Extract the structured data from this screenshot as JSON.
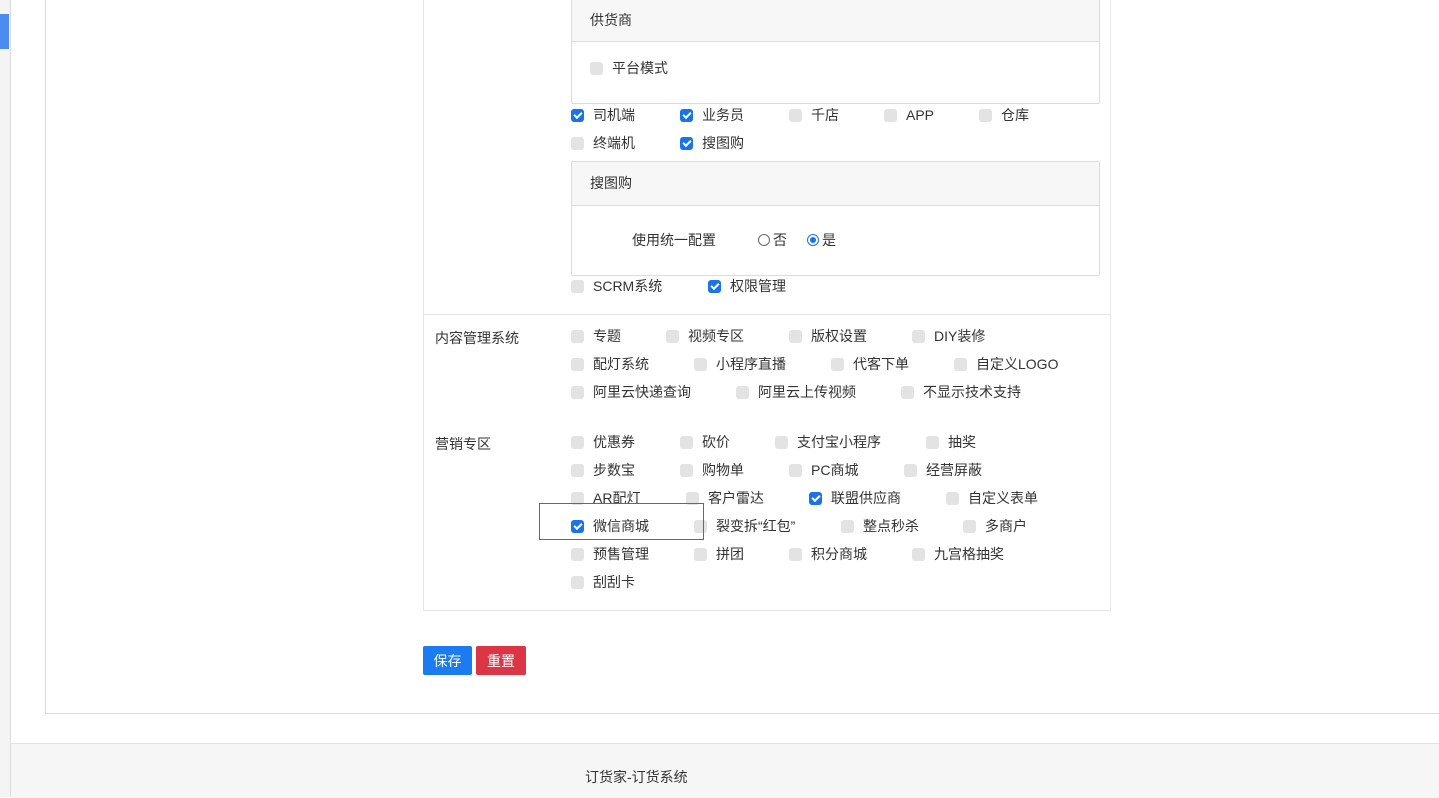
{
  "supplier_panel": {
    "title": "供货商",
    "items": [
      {
        "label": "平台模式",
        "checked": false
      }
    ]
  },
  "modules": {
    "row1": [
      {
        "label": "司机端",
        "checked": true
      },
      {
        "label": "业务员",
        "checked": true
      },
      {
        "label": "千店",
        "checked": false
      },
      {
        "label": "APP",
        "checked": false
      },
      {
        "label": "仓库",
        "checked": false
      }
    ],
    "row2": [
      {
        "label": "终端机",
        "checked": false
      },
      {
        "label": "搜图购",
        "checked": true
      }
    ]
  },
  "soutugou_panel": {
    "title": "搜图购",
    "config_label": "使用统一配置",
    "options": [
      {
        "label": "否",
        "selected": false
      },
      {
        "label": "是",
        "selected": true
      }
    ]
  },
  "modules_extra": [
    {
      "label": "SCRM系统",
      "checked": false
    },
    {
      "label": "权限管理",
      "checked": true
    }
  ],
  "cms": {
    "title": "内容管理系统",
    "items": [
      {
        "label": "专题",
        "checked": false
      },
      {
        "label": "视频专区",
        "checked": false
      },
      {
        "label": "版权设置",
        "checked": false
      },
      {
        "label": "DIY装修",
        "checked": false
      },
      {
        "label": "配灯系统",
        "checked": false
      },
      {
        "label": "小程序直播",
        "checked": false
      },
      {
        "label": "代客下单",
        "checked": false
      },
      {
        "label": "自定义LOGO",
        "checked": false
      },
      {
        "label": "阿里云快递查询",
        "checked": false
      },
      {
        "label": "阿里云上传视频",
        "checked": false
      },
      {
        "label": "不显示技术支持",
        "checked": false
      }
    ]
  },
  "marketing": {
    "title": "营销专区",
    "items": [
      {
        "label": "优惠券",
        "checked": false
      },
      {
        "label": "砍价",
        "checked": false
      },
      {
        "label": "支付宝小程序",
        "checked": false
      },
      {
        "label": "抽奖",
        "checked": false
      },
      {
        "label": "步数宝",
        "checked": false
      },
      {
        "label": "购物单",
        "checked": false
      },
      {
        "label": "PC商城",
        "checked": false
      },
      {
        "label": "经营屏蔽",
        "checked": false
      },
      {
        "label": "AR配灯",
        "checked": false
      },
      {
        "label": "客户雷达",
        "checked": false
      },
      {
        "label": "联盟供应商",
        "checked": true
      },
      {
        "label": "自定义表单",
        "checked": false
      },
      {
        "label": "微信商城",
        "checked": true
      },
      {
        "label": "裂变拆“红包”",
        "checked": false
      },
      {
        "label": "整点秒杀",
        "checked": false
      },
      {
        "label": "多商户",
        "checked": false
      },
      {
        "label": "预售管理",
        "checked": false
      },
      {
        "label": "拼团",
        "checked": false
      },
      {
        "label": "积分商城",
        "checked": false
      },
      {
        "label": "九宫格抽奖",
        "checked": false
      },
      {
        "label": "刮刮卡",
        "checked": false
      }
    ]
  },
  "buttons": {
    "save": "保存",
    "reset": "重置"
  },
  "footer": {
    "text": "订货家-订货系统"
  },
  "colors": {
    "primary": "#1a7cf0",
    "danger": "#dc3545",
    "checked": "#1a73e8",
    "highlight": "#d9363e"
  }
}
